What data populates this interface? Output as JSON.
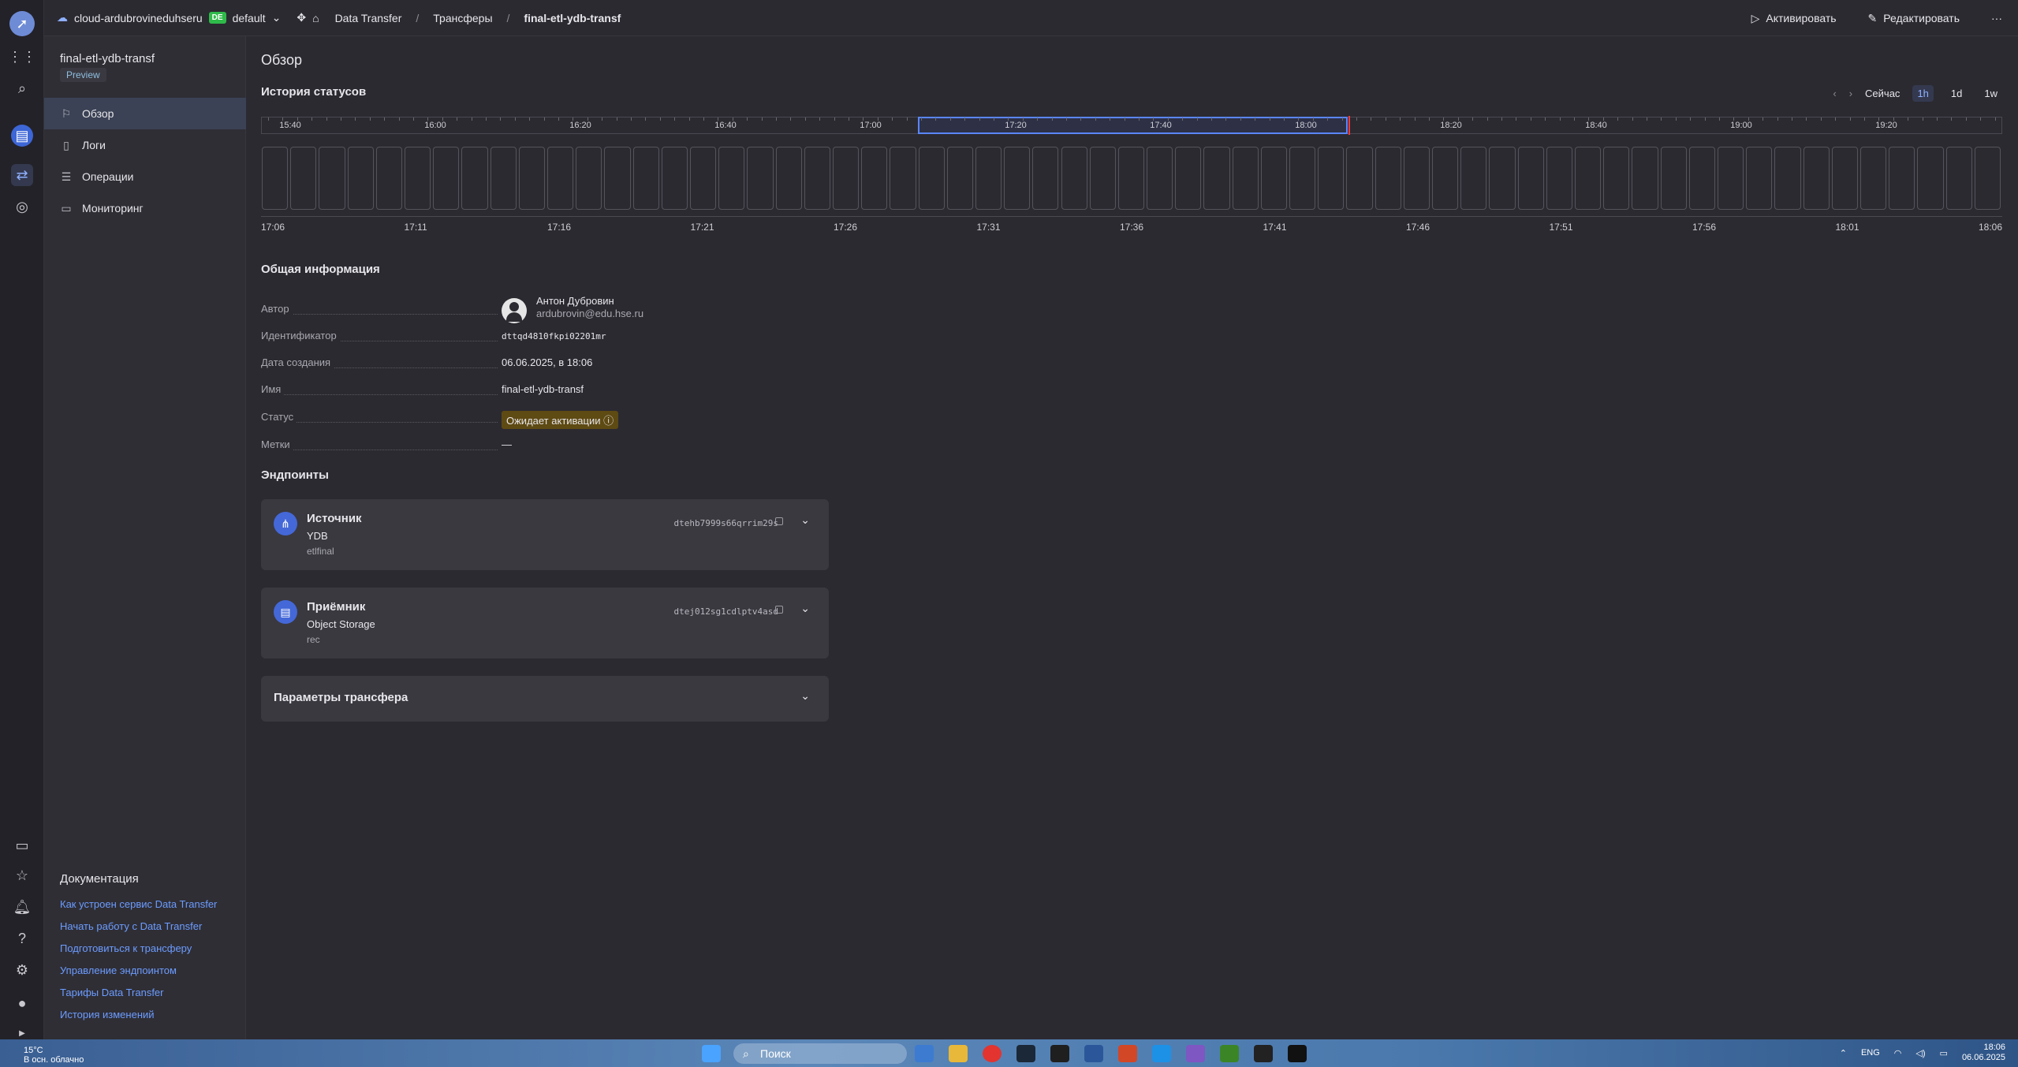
{
  "topbar": {
    "cloud": "cloud-ardubrovineduhseru",
    "folder_badge": "DE",
    "folder": "default",
    "crumbs": [
      "Data Transfer",
      "Трансферы",
      "final-etl-ydb-transf"
    ],
    "activate": "Активировать",
    "edit": "Редактировать",
    "more": "···"
  },
  "sidebar": {
    "title": "final-etl-ydb-transf",
    "badge": "Preview",
    "items": [
      {
        "label": "Обзор",
        "icon": "flag-icon"
      },
      {
        "label": "Логи",
        "icon": "document-icon"
      },
      {
        "label": "Операции",
        "icon": "list-icon"
      },
      {
        "label": "Мониторинг",
        "icon": "monitor-icon"
      }
    ],
    "docs_title": "Документация",
    "docs": [
      "Как устроен сервис Data Transfer",
      "Начать работу с Data Transfer",
      "Подготовиться к трансферу",
      "Управление эндпоинтом",
      "Тарифы Data Transfer",
      "История изменений"
    ]
  },
  "main": {
    "title": "Обзор",
    "history_title": "История статусов",
    "history_controls": {
      "now": "Сейчас",
      "ranges": [
        "1h",
        "1d",
        "1w"
      ],
      "selected": "1h"
    },
    "ruler_labels": [
      "15:40",
      "16:00",
      "16:20",
      "16:40",
      "17:00",
      "17:20",
      "17:40",
      "18:00",
      "18:20",
      "18:40",
      "19:00",
      "19:20"
    ],
    "axis_labels": [
      "17:06",
      "17:11",
      "17:16",
      "17:21",
      "17:26",
      "17:31",
      "17:36",
      "17:41",
      "17:46",
      "17:51",
      "17:56",
      "18:01",
      "18:06"
    ],
    "bar_count": 61,
    "info_title": "Общая информация",
    "info": {
      "author_label": "Автор",
      "author_name": "Антон Дубровин",
      "author_email": "ardubrovin@edu.hse.ru",
      "id_label": "Идентификатор",
      "id_value": "dttqd4810fkpi02201mr",
      "created_label": "Дата создания",
      "created_value": "06.06.2025, в 18:06",
      "name_label": "Имя",
      "name_value": "final-etl-ydb-transf",
      "status_label": "Статус",
      "status_value": "Ожидает активации",
      "labels_label": "Метки",
      "labels_value": "—"
    },
    "endpoints_title": "Эндпоинты",
    "source": {
      "title": "Источник",
      "type": "YDB",
      "name": "etlfinal",
      "id": "dtehb7999s66qrrim29s"
    },
    "target": {
      "title": "Приёмник",
      "type": "Object Storage",
      "name": "rec",
      "id": "dtej012sg1cdlptv4asd"
    },
    "params_title": "Параметры трансфера"
  },
  "taskbar": {
    "temp": "15°C",
    "weather": "В осн. облачно",
    "search": "Поиск",
    "lang": "ENG",
    "time": "18:06",
    "date": "06.06.2025"
  },
  "colors": {
    "accent": "#5a86ff",
    "status_bg": "#5e4a13",
    "status_fg": "#ffd04a",
    "now_line": "#ff3b3b"
  }
}
